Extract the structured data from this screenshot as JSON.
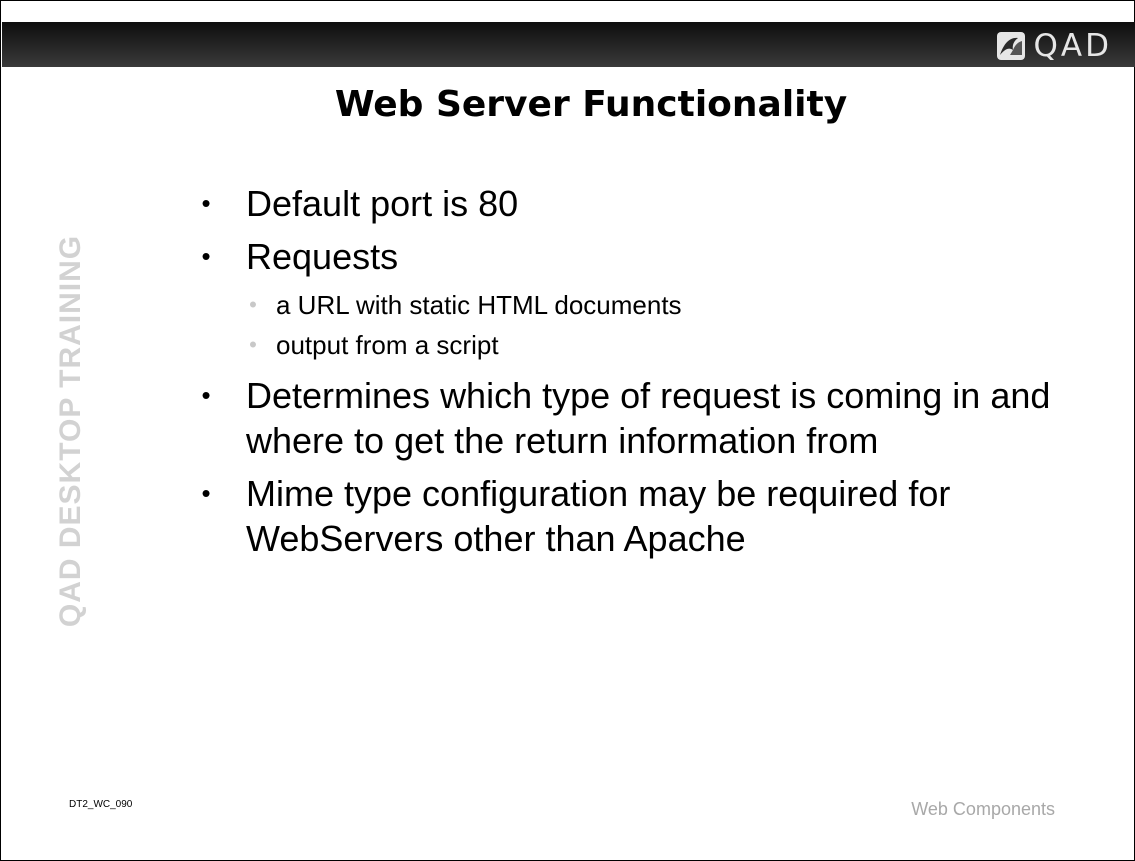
{
  "logo": {
    "text": "QAD",
    "icon": "qad-logo-icon"
  },
  "slide": {
    "title": "Web Server Functionality",
    "side_label": "QAD DESKTOP TRAINING",
    "bullets": [
      {
        "text": "Default port is 80",
        "subitems": []
      },
      {
        "text": "Requests",
        "subitems": [
          "a URL with static HTML documents",
          "output from a script"
        ]
      },
      {
        "text": "Determines which type of request is coming in and where to get the return information from",
        "subitems": []
      },
      {
        "text": "Mime type configuration may be required for WebServers other than Apache",
        "subitems": []
      }
    ],
    "bullet_glyph": "•",
    "sub_bullet_glyph": "•"
  },
  "footer": {
    "code": "DT2_WC_090",
    "label": "Web Components"
  },
  "colors": {
    "header_band": "#1a1a1a",
    "side_label": "#d2d2d2",
    "footer_label": "#a8a8a8",
    "sub_bullet": "#c8c8c8"
  }
}
